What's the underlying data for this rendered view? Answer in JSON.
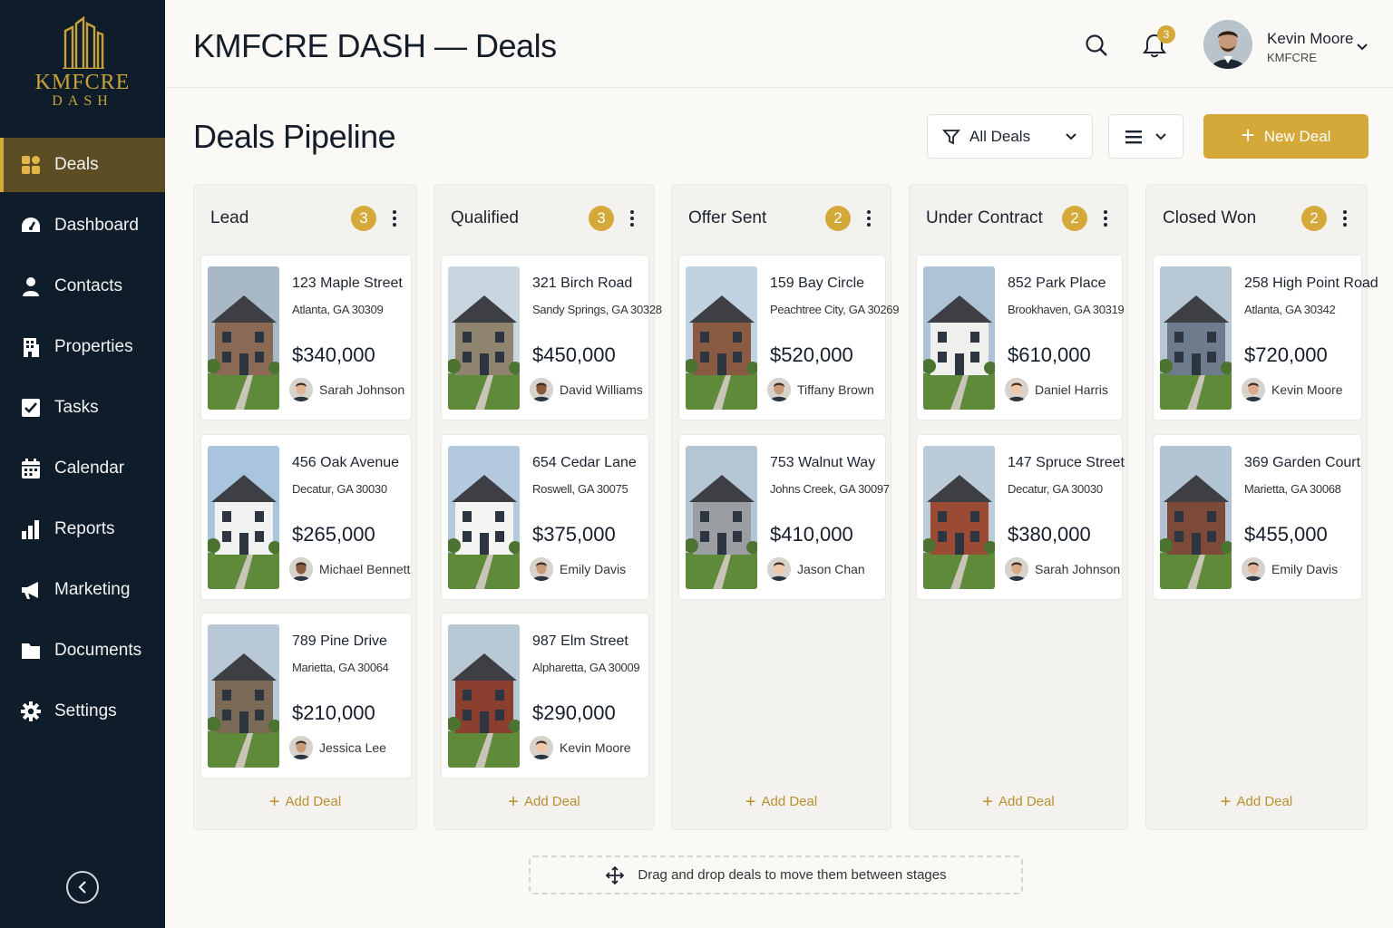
{
  "brand": {
    "line1": "KMFCRE",
    "line2": "DASH"
  },
  "nav": [
    {
      "label": "Deals",
      "icon": "deals-grid-icon",
      "active": true
    },
    {
      "label": "Dashboard",
      "icon": "dashboard-gauge-icon",
      "active": false
    },
    {
      "label": "Contacts",
      "icon": "person-icon",
      "active": false
    },
    {
      "label": "Properties",
      "icon": "building-icon",
      "active": false
    },
    {
      "label": "Tasks",
      "icon": "checkbox-icon",
      "active": false
    },
    {
      "label": "Calendar",
      "icon": "calendar-icon",
      "active": false
    },
    {
      "label": "Reports",
      "icon": "bar-chart-icon",
      "active": false
    },
    {
      "label": "Marketing",
      "icon": "megaphone-icon",
      "active": false
    },
    {
      "label": "Documents",
      "icon": "folder-icon",
      "active": false
    },
    {
      "label": "Settings",
      "icon": "gear-icon",
      "active": false
    }
  ],
  "header": {
    "title": "KMFCRE DASH — Deals",
    "notifications": "3",
    "user": {
      "name": "Kevin Moore",
      "org": "KMFCRE"
    }
  },
  "page": {
    "title": "Deals Pipeline",
    "filter_label": "All Deals",
    "new_deal_label": "New Deal",
    "add_deal_label": "Add Deal",
    "hint": "Drag and drop deals to move them between stages"
  },
  "colors": {
    "accent": "#d4a93a",
    "sidebar": "#0f1d2b",
    "active_nav": "#5c4d25"
  },
  "columns": [
    {
      "title": "Lead",
      "count": "3",
      "deals": [
        {
          "street": "123 Maple Street",
          "city": "Atlanta, GA 30309",
          "price": "$340,000",
          "agent": "Sarah Johnson"
        },
        {
          "street": "456 Oak Avenue",
          "city": "Decatur, GA 30030",
          "price": "$265,000",
          "agent": "Michael Bennett"
        },
        {
          "street": "789 Pine Drive",
          "city": "Marietta, GA 30064",
          "price": "$210,000",
          "agent": "Jessica Lee"
        }
      ]
    },
    {
      "title": "Qualified",
      "count": "3",
      "deals": [
        {
          "street": "321 Birch Road",
          "city": "Sandy Springs, GA 30328",
          "price": "$450,000",
          "agent": "David Williams"
        },
        {
          "street": "654 Cedar Lane",
          "city": "Roswell, GA 30075",
          "price": "$375,000",
          "agent": "Emily Davis"
        },
        {
          "street": "987 Elm Street",
          "city": "Alpharetta, GA 30009",
          "price": "$290,000",
          "agent": "Kevin Moore"
        }
      ]
    },
    {
      "title": "Offer Sent",
      "count": "2",
      "deals": [
        {
          "street": "159 Bay Circle",
          "city": "Peachtree City, GA 30269",
          "price": "$520,000",
          "agent": "Tiffany Brown"
        },
        {
          "street": "753 Walnut Way",
          "city": "Johns Creek, GA 30097",
          "price": "$410,000",
          "agent": "Jason Chan"
        }
      ]
    },
    {
      "title": "Under Contract",
      "count": "2",
      "deals": [
        {
          "street": "852 Park Place",
          "city": "Brookhaven, GA 30319",
          "price": "$610,000",
          "agent": "Daniel Harris"
        },
        {
          "street": "147 Spruce Street",
          "city": "Decatur, GA 30030",
          "price": "$380,000",
          "agent": "Sarah Johnson"
        }
      ]
    },
    {
      "title": "Closed Won",
      "count": "2",
      "deals": [
        {
          "street": "258 High Point Road",
          "city": "Atlanta, GA 30342",
          "price": "$720,000",
          "agent": "Kevin Moore"
        },
        {
          "street": "369 Garden Court",
          "city": "Marietta, GA 30068",
          "price": "$455,000",
          "agent": "Emily Davis"
        }
      ]
    }
  ]
}
